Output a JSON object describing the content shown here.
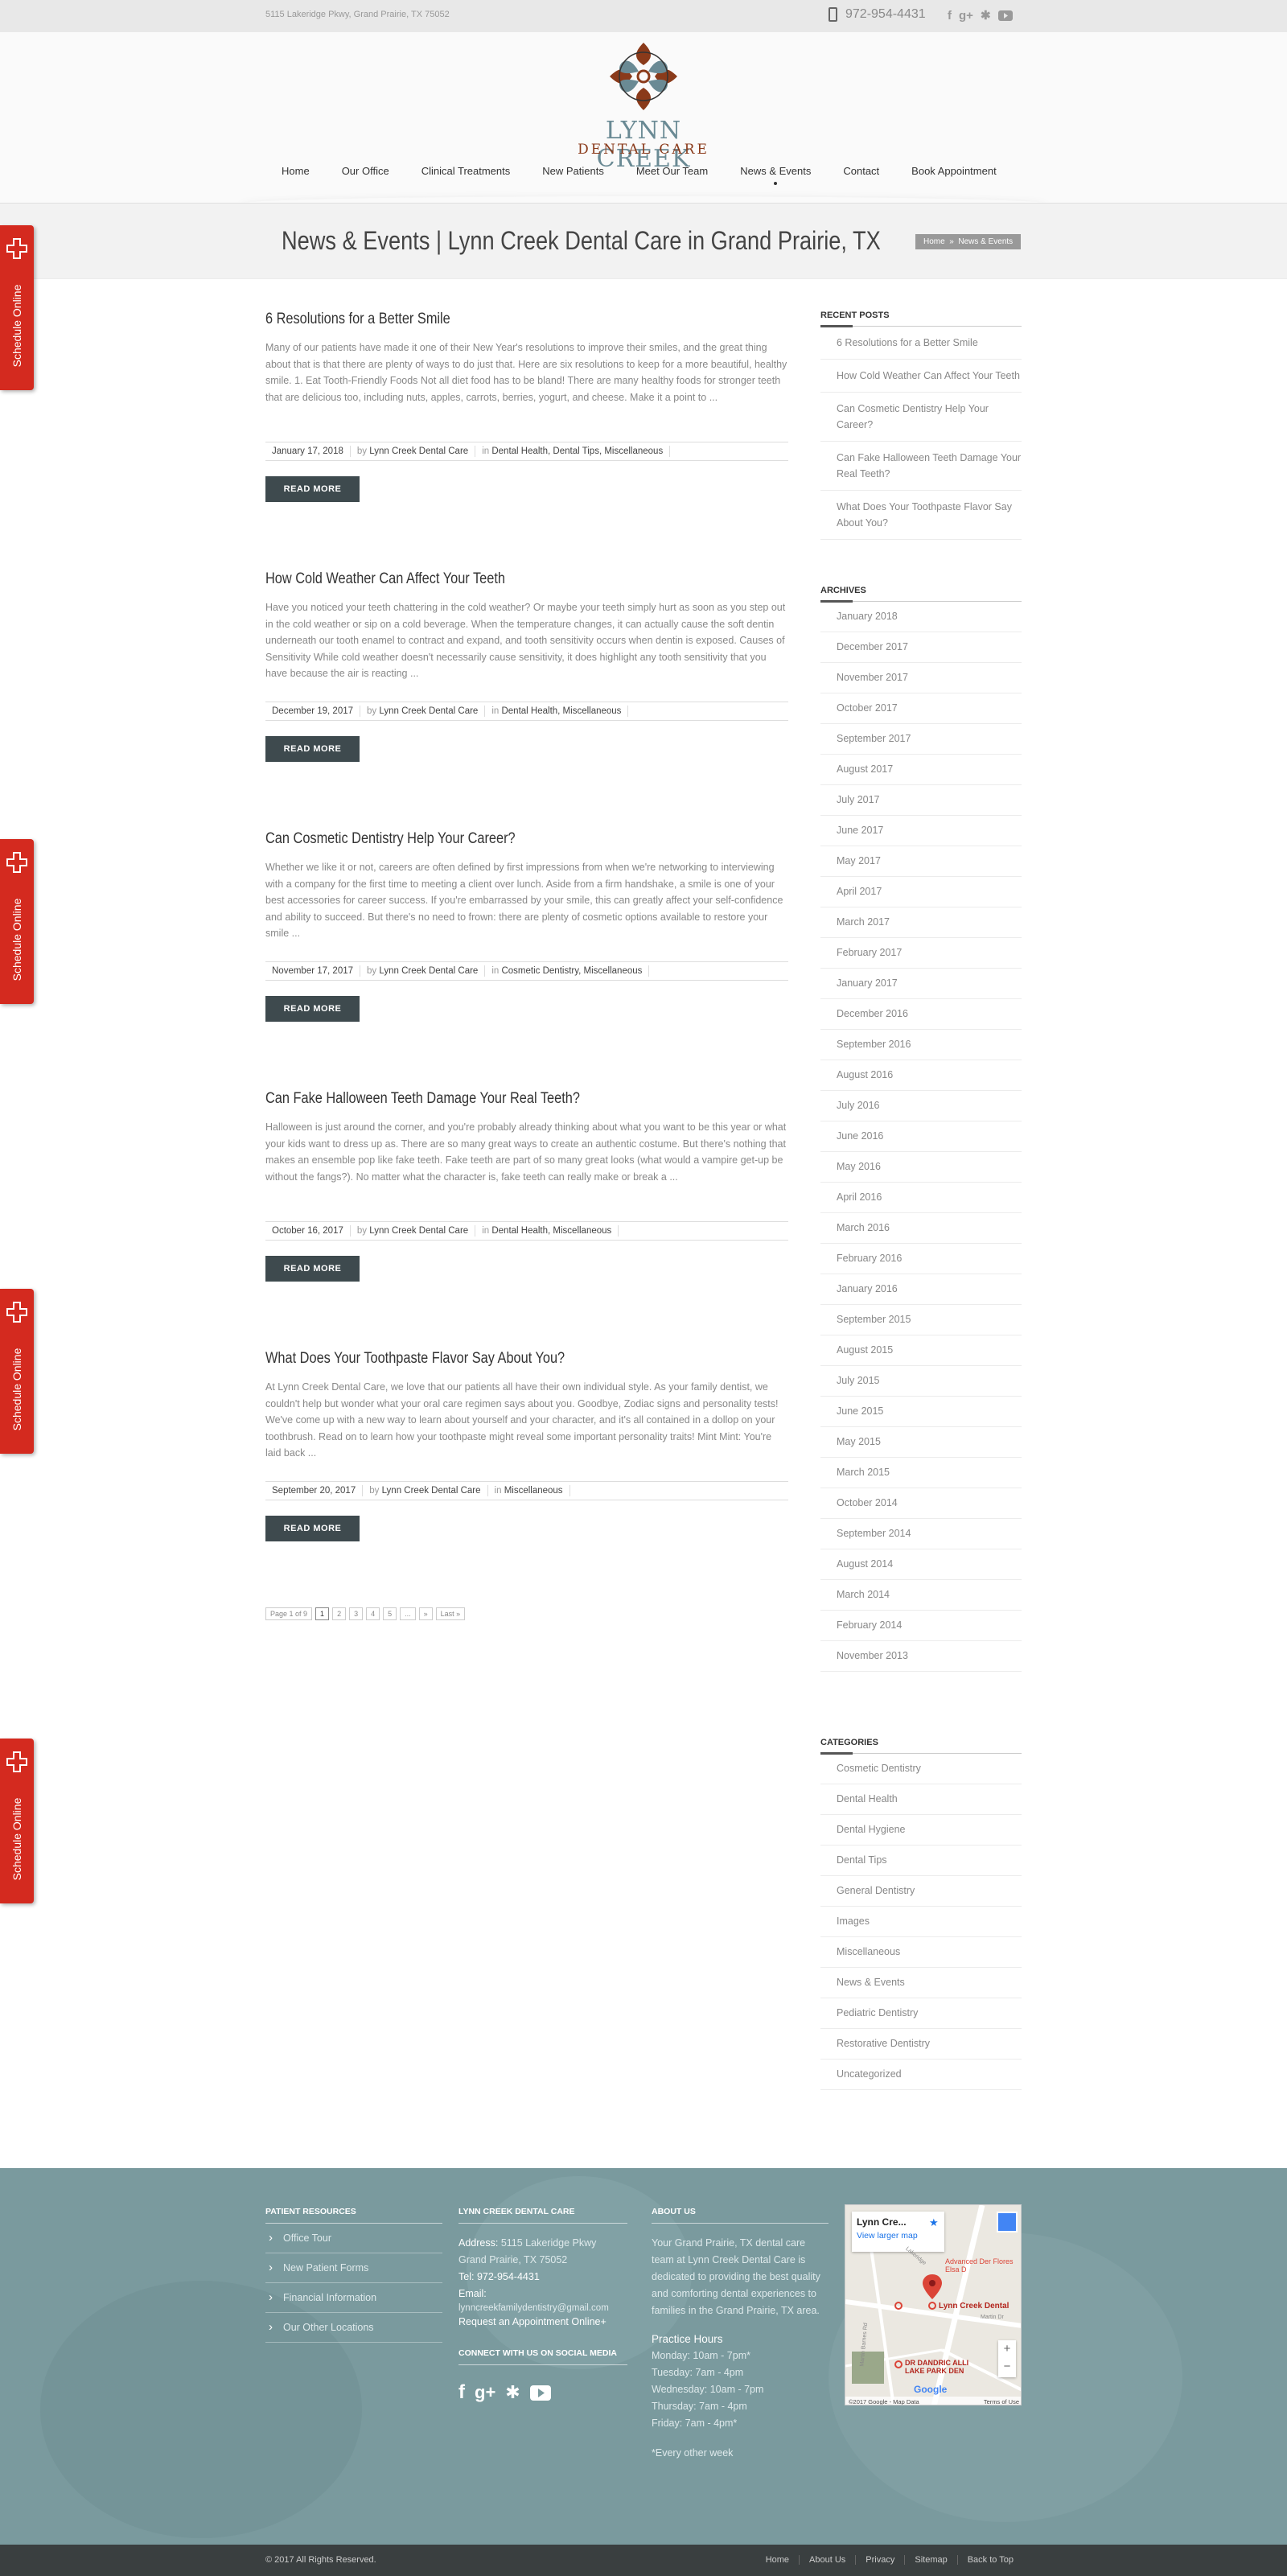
{
  "topbar": {
    "address": "5115 Lakeridge Pkwy, Grand Prairie, TX 75052",
    "phone": "972-954-4431",
    "social": [
      "facebook-icon",
      "google-plus-icon",
      "yelp-icon",
      "youtube-icon"
    ]
  },
  "logo": {
    "line1": "LYNN CREEK",
    "line2": "DENTAL CARE"
  },
  "nav": [
    "Home",
    "Our Office",
    "Clinical Treatments",
    "New Patients",
    "Meet Our Team",
    "News & Events",
    "Contact",
    "Book Appointment"
  ],
  "page": {
    "title": "News & Events | Lynn Creek Dental Care in Grand Prairie, TX",
    "crumb_home": "Home",
    "crumb_sep": "»",
    "crumb_current": "News & Events"
  },
  "side_tab": {
    "label": "Schedule Online"
  },
  "posts": [
    {
      "title": "6 Resolutions for a Better Smile",
      "excerpt": "Many of our patients have made it one of their New Year's resolutions to improve their smiles, and the great thing about that is that there are plenty of ways to do just that. Here are six resolutions to keep for a more beautiful, healthy smile.  1. Eat Tooth-Friendly Foods Not all diet food has to be bland! There are many healthy foods for stronger teeth that are delicious too, including nuts, apples, carrots, berries, yogurt, and cheese. Make it a point to ...",
      "date": "January 17, 2018",
      "author": "Lynn Creek Dental Care",
      "cats": "Dental Health, Dental Tips, Miscellaneous"
    },
    {
      "title": "How Cold Weather Can Affect Your Teeth",
      "excerpt": "Have you noticed your teeth chattering in the cold weather? Or maybe your teeth simply hurt as soon as you step out in the cold weather or sip on a cold beverage. When the temperature changes, it can actually cause the soft dentin underneath our tooth enamel to contract and expand, and tooth sensitivity occurs when dentin is exposed. Causes of Sensitivity While cold weather doesn't necessarily cause sensitivity, it does highlight any tooth sensitivity that you have because the air is reacting ...",
      "date": "December 19, 2017",
      "author": "Lynn Creek Dental Care",
      "cats": "Dental Health, Miscellaneous"
    },
    {
      "title": "Can Cosmetic Dentistry Help Your Career?",
      "excerpt": "Whether we like it or not, careers are often defined by first impressions from when we're networking to interviewing with a company for the first time to meeting a client over lunch. Aside from a firm handshake, a smile is one of your best accessories for career success. If you're embarrassed by your smile, this can greatly affect your self-confidence and ability to succeed. But there's no need to frown: there are plenty of cosmetic options available to restore your smile ...",
      "date": "November 17, 2017",
      "author": "Lynn Creek Dental Care",
      "cats": "Cosmetic Dentistry, Miscellaneous"
    },
    {
      "title": "Can Fake Halloween Teeth Damage Your Real Teeth?",
      "excerpt": "Halloween is just around the corner, and you're probably already thinking about what you want to be this year or what your kids want to dress up as. There are so many great ways to create an authentic costume. But there's nothing that makes an ensemble pop like fake teeth. Fake teeth are part of so many great looks (what would a vampire get-up be without the fangs?). No matter what the character is, fake teeth can really make or break a ...",
      "date": "October 16, 2017",
      "author": "Lynn Creek Dental Care",
      "cats": "Dental Health, Miscellaneous"
    },
    {
      "title": "What Does Your Toothpaste Flavor Say About You?",
      "excerpt": "At Lynn Creek Dental Care, we love that our patients all have their own individual style. As your family dentist, we couldn't help but wonder what your oral care regimen says about you. Goodbye, Zodiac signs and personality tests! We've come up with a new way to learn about yourself and your character, and it's all contained in a dollop on your toothbrush. Read on to learn how your toothpaste might reveal some important personality traits! Mint Mint: You're laid back ...",
      "date": "September 20, 2017",
      "author": "Lynn Creek Dental Care",
      "cats": "Miscellaneous"
    }
  ],
  "post_labels": {
    "by": "by",
    "in": "in",
    "read_more": "READ MORE"
  },
  "pager": [
    "Page 1 of 9",
    "1",
    "2",
    "3",
    "4",
    "5",
    "...",
    "»",
    "Last »"
  ],
  "sidebar": {
    "recent_title": "RECENT POSTS",
    "recent": [
      "6 Resolutions for a Better Smile",
      "How Cold Weather Can Affect Your Teeth",
      "Can Cosmetic Dentistry Help Your Career?",
      "Can Fake Halloween Teeth Damage Your Real Teeth?",
      "What Does Your Toothpaste Flavor Say About You?"
    ],
    "archives_title": "ARCHIVES",
    "archives": [
      "January 2018",
      "December 2017",
      "November 2017",
      "October 2017",
      "September 2017",
      "August 2017",
      "July 2017",
      "June 2017",
      "May 2017",
      "April 2017",
      "March 2017",
      "February 2017",
      "January 2017",
      "December 2016",
      "September 2016",
      "August 2016",
      "July 2016",
      "June 2016",
      "May 2016",
      "April 2016",
      "March 2016",
      "February 2016",
      "January 2016",
      "September 2015",
      "August 2015",
      "July 2015",
      "June 2015",
      "May 2015",
      "March 2015",
      "October 2014",
      "September 2014",
      "August 2014",
      "March 2014",
      "February 2014",
      "November 2013"
    ],
    "categories_title": "CATEGORIES",
    "categories": [
      "Cosmetic Dentistry",
      "Dental Health",
      "Dental Hygiene",
      "Dental Tips",
      "General Dentistry",
      "Images",
      "Miscellaneous",
      "News & Events",
      "Pediatric Dentistry",
      "Restorative Dentistry",
      "Uncategorized"
    ]
  },
  "footer": {
    "resources_title": "PATIENT RESOURCES",
    "resources": [
      "Office Tour",
      "New Patient Forms",
      "Financial Information",
      "Our Other Locations"
    ],
    "contact_title": "LYNN CREEK DENTAL CARE",
    "address_label": "Address:",
    "address1": "5115 Lakeridge Pkwy",
    "address2": "Grand Prairie, TX 75052",
    "tel_label": "Tel:",
    "tel": "972-954-4431",
    "email_label": "Email:",
    "email": "lynncreekfamilydentistry@gmail.com",
    "request": "Request an Appointment Online+",
    "social_title": "CONNECT WITH US ON SOCIAL MEDIA",
    "about_title": "ABOUT US",
    "about": "Your Grand Prairie, TX dental care team at Lynn Creek Dental Care is dedicated to providing the best quality and comforting dental experiences to families in the Grand Prairie, TX area.",
    "hours_title": "Practice Hours",
    "hours": [
      "Monday: 10am - 7pm*",
      "Tuesday: 7am - 4pm",
      "Wednesday: 10am - 7pm",
      "Thursday: 7am - 4pm",
      "Friday: 7am - 4pm*"
    ],
    "hours_note": "*Every other week",
    "map": {
      "place": "Lynn Cre...",
      "view_larger": "View larger map",
      "pin1": "Advanced Der Flores Elsa D",
      "pin2": "Lynn Creek Dental",
      "pin3": "DR DANDRIC ALLI LAKE PARK DEN",
      "road1": "Martin Dr",
      "road2": "Martin Barnes Rd",
      "road3": "Lakeridge",
      "google": "Google",
      "attribution": "©2017 Google - Map Data",
      "terms": "Terms of Use",
      "zoom_in": "+",
      "zoom_out": "−"
    }
  },
  "bottom": {
    "copyright": "© 2017 All Rights Reserved.",
    "links": [
      "Home",
      "About Us",
      "Privacy",
      "Sitemap",
      "Back to Top"
    ]
  }
}
